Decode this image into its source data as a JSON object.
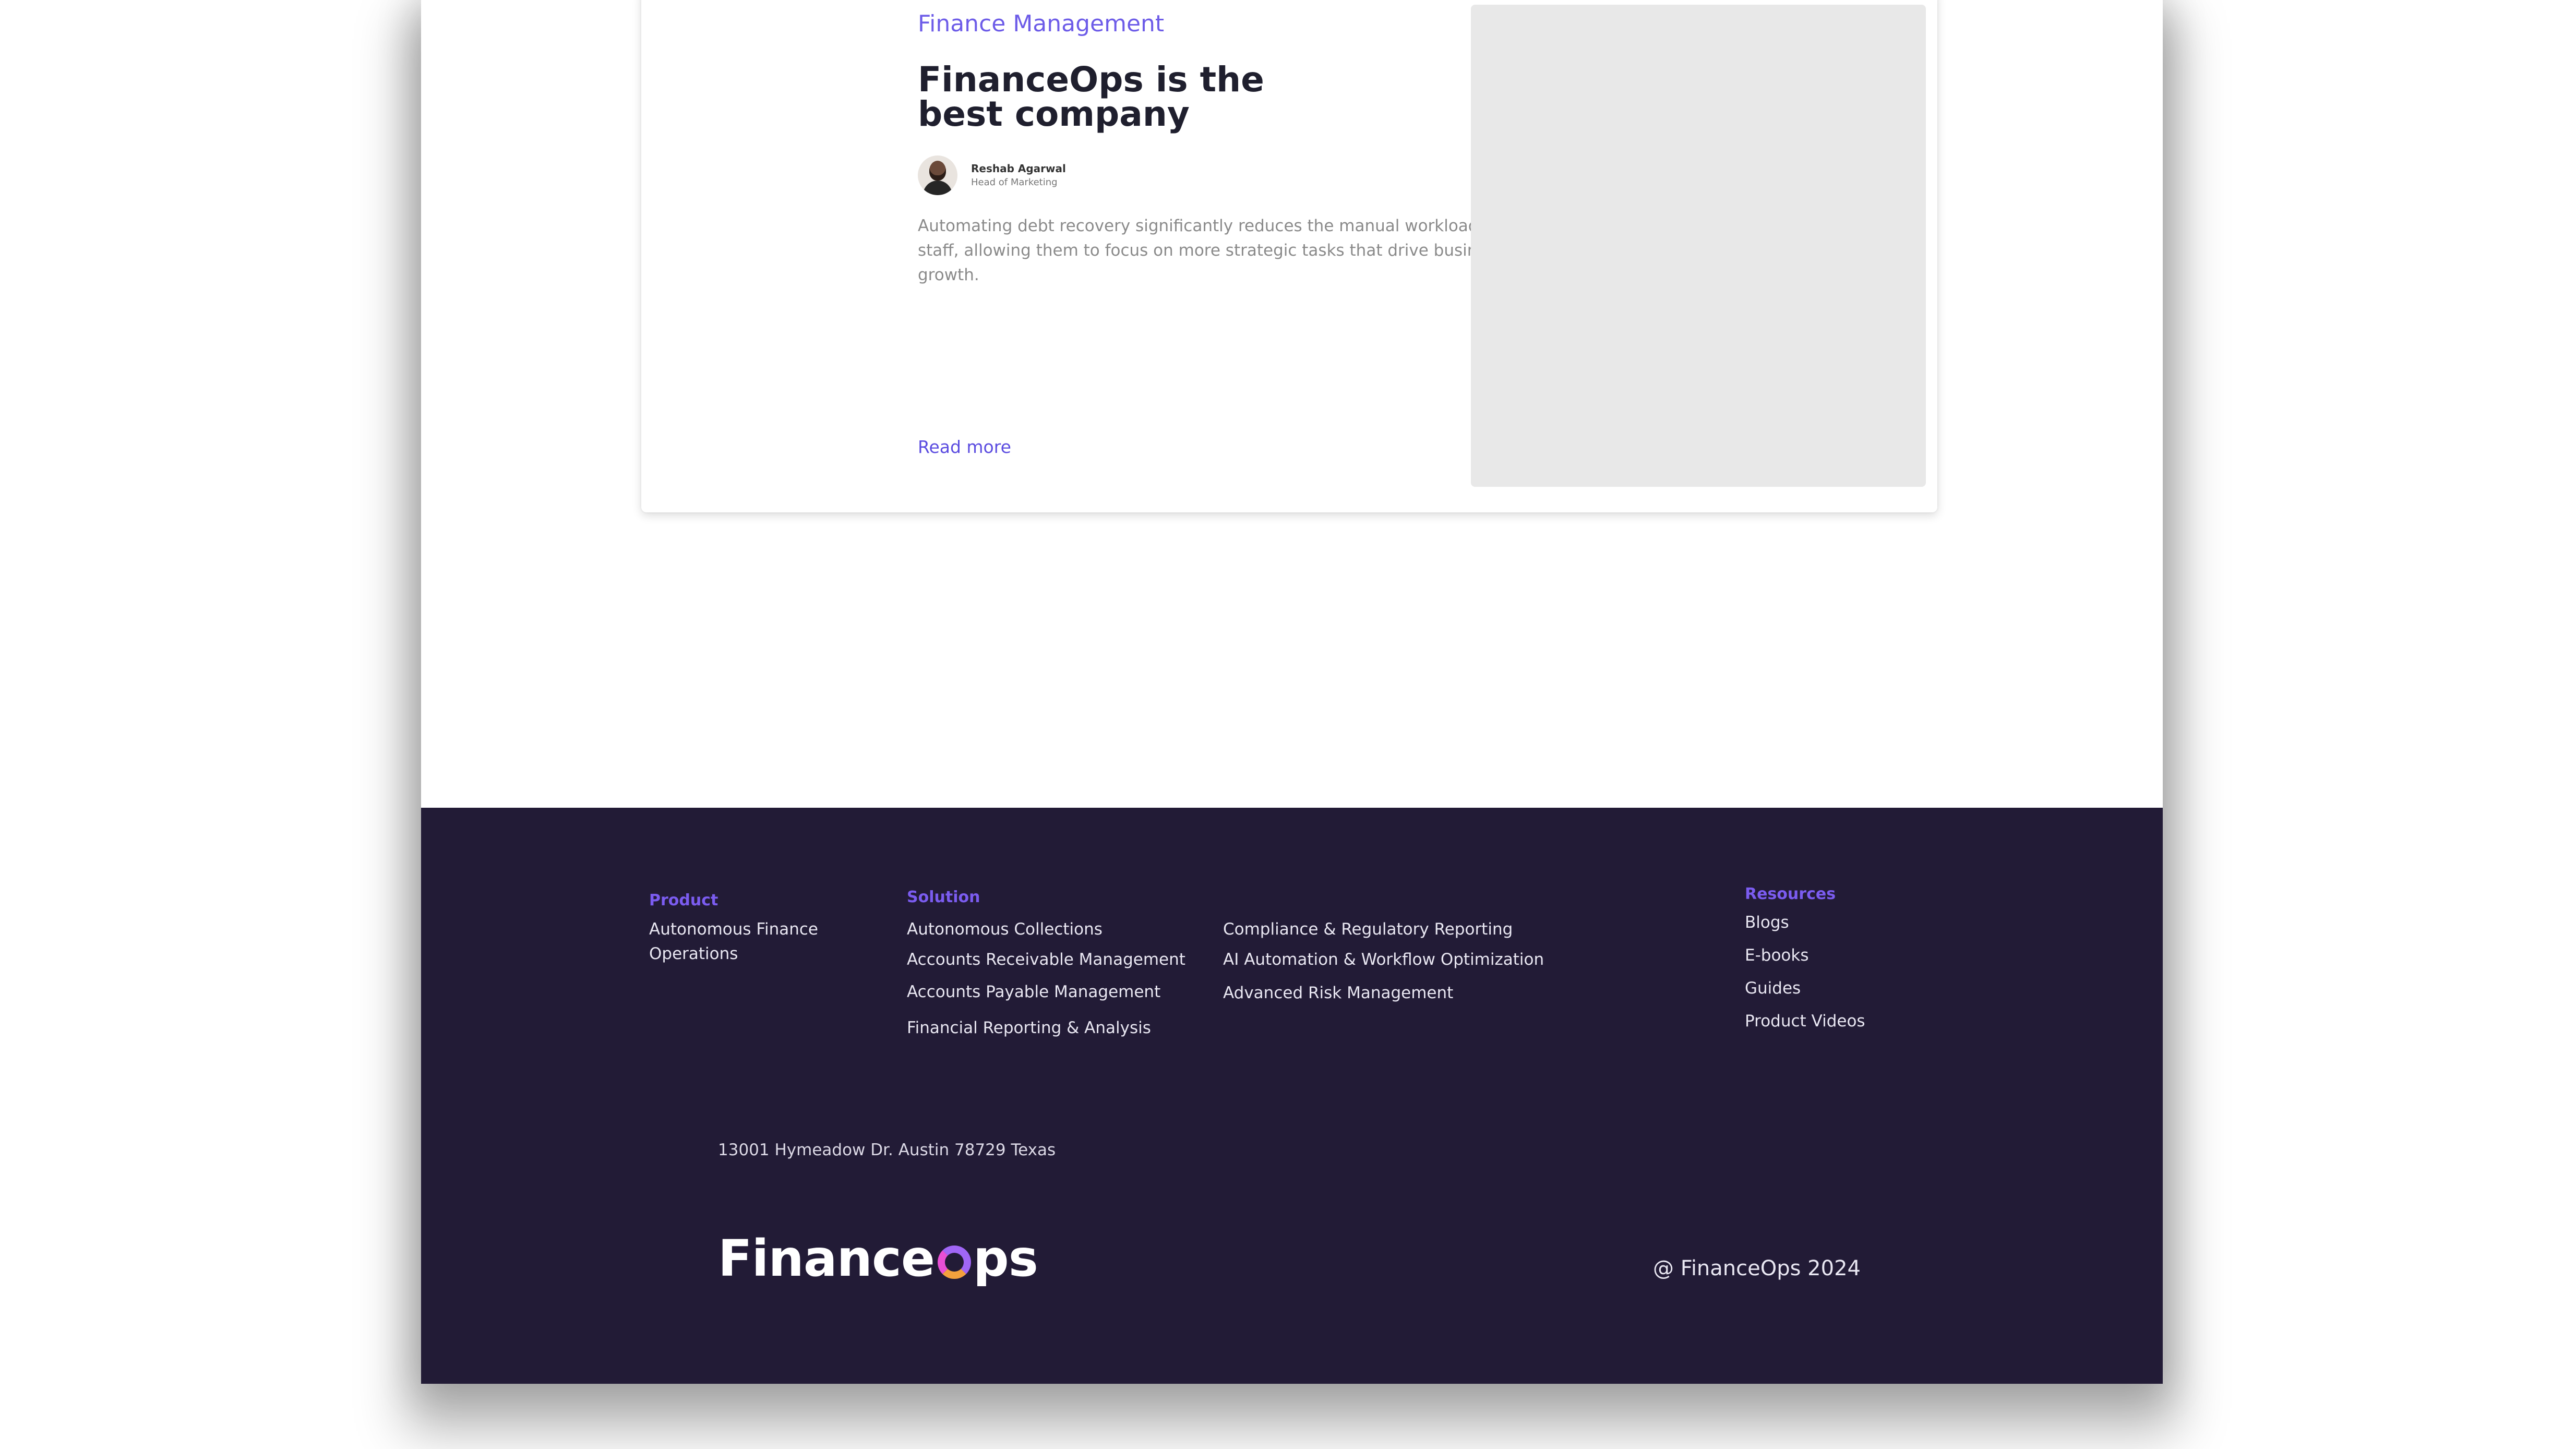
{
  "article": {
    "category": "Finance Management",
    "title_line1": "FinanceOps is the",
    "title_line2": "best company",
    "author_name": "Reshab Agarwal",
    "author_role": "Head of Marketing",
    "excerpt": "Automating debt recovery  significantly reduces the manual workload on your staff, allowing them to focus on more strategic tasks that drive business growth.",
    "read_more": "Read more"
  },
  "footer": {
    "product": {
      "title": "Product",
      "items": [
        "Autonomous Finance",
        "Operations"
      ]
    },
    "solution": {
      "title": "Solution",
      "col1": [
        "Autonomous Collections",
        "Accounts Receivable Management",
        "Accounts Payable Management",
        "Financial Reporting & Analysis"
      ],
      "col2": [
        "Compliance & Regulatory Reporting",
        "AI Automation & Workflow Optimization",
        "Advanced Risk Management"
      ]
    },
    "resources": {
      "title": "Resources",
      "items": [
        "Blogs",
        "E-books",
        "Guides",
        "Product Videos"
      ]
    },
    "address": "13001 Hymeadow Dr. Austin 78729 Texas",
    "logo": {
      "part1": "Finance",
      "part2": "ps"
    },
    "copyright": "@ FinanceOps 2024"
  }
}
